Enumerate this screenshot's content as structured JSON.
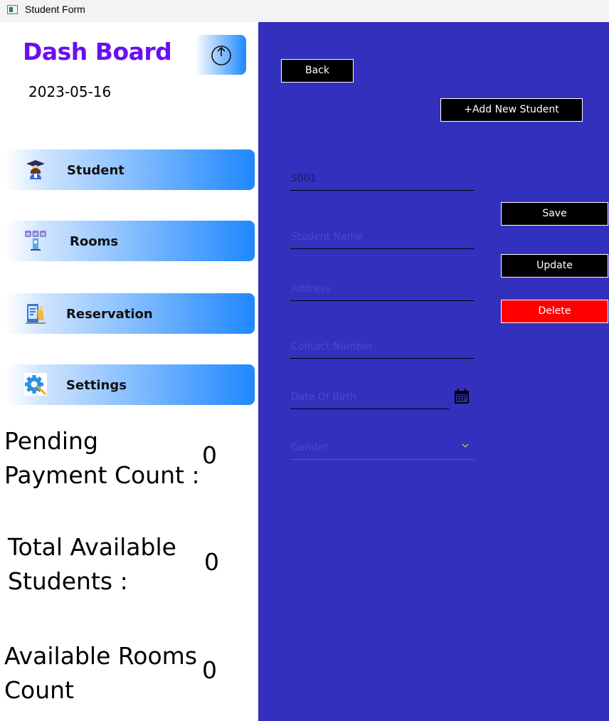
{
  "window": {
    "title": "Student Form"
  },
  "sidebar": {
    "title": "Dash Board",
    "date": "2023-05-16",
    "nav": {
      "student": "Student",
      "rooms": "Rooms",
      "reservation": "Reservation",
      "settings": "Settings"
    },
    "stats": {
      "pending_label_1": "Pending",
      "pending_label_2": "Payment Count :",
      "pending_value": "0",
      "students_label_1": "Total Available",
      "students_label_2": "Students :",
      "students_value": "0",
      "rooms_label_1": "Available Rooms",
      "rooms_label_2": "Count",
      "rooms_value": "0"
    }
  },
  "form": {
    "back_label": "Back",
    "add_label": "+Add New Student",
    "student_id_value": "S001",
    "name_placeholder": "Student Name",
    "address_placeholder": "Address",
    "contact_placeholder": "Contact Number",
    "dob_placeholder": "Date Of Birth",
    "gender_placeholder": "Gender",
    "save_label": "Save",
    "update_label": "Update",
    "delete_label": "Delete"
  },
  "colors": {
    "title_purple": "#6a0ff0",
    "panel_blue": "#3330be",
    "delete_red": "#ff0000",
    "nav_gradient_end": "#1e88ff"
  }
}
